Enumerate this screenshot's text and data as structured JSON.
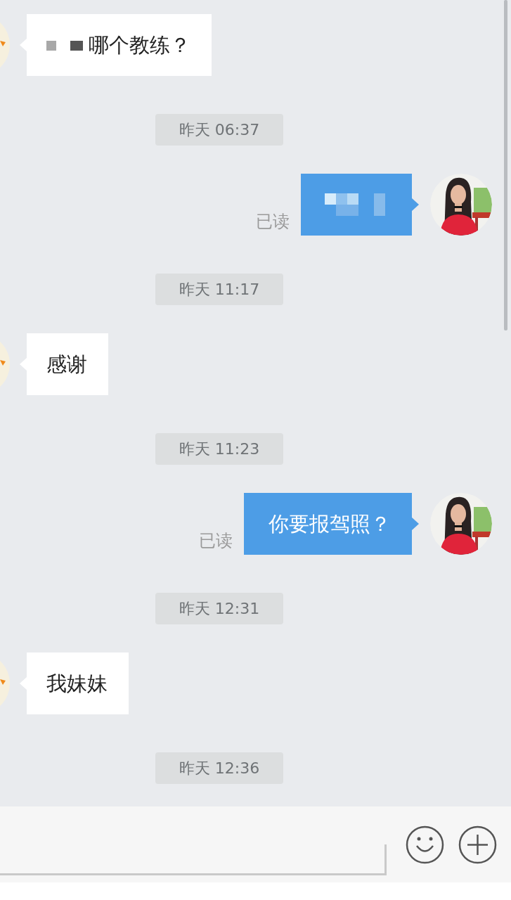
{
  "messages": [
    {
      "kind": "incoming",
      "text": "哪个教练？",
      "redacted_prefix": true
    },
    {
      "kind": "time",
      "text": "昨天 06:37"
    },
    {
      "kind": "outgoing",
      "redacted": true,
      "read_label": "已读"
    },
    {
      "kind": "time",
      "text": "昨天 11:17"
    },
    {
      "kind": "incoming",
      "text": "感谢",
      "redacted_prefix": false
    },
    {
      "kind": "time",
      "text": "昨天 11:23"
    },
    {
      "kind": "outgoing",
      "text": "你要报驾照？",
      "redacted": false,
      "read_label": "已读"
    },
    {
      "kind": "time",
      "text": "昨天 12:31"
    },
    {
      "kind": "incoming",
      "text": "我妹妹",
      "redacted_prefix": false
    },
    {
      "kind": "time",
      "text": "昨天 12:36"
    }
  ]
}
